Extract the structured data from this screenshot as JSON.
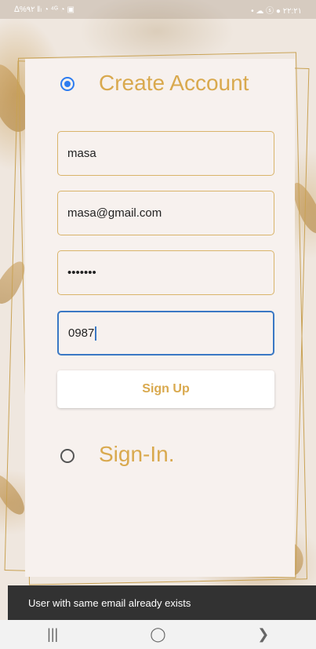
{
  "status_bar": {
    "left_text": "ᐃ%٩٢ ‖ₗ ◔ ⁴ᴳ ◔ ▣",
    "right_text": "• ☁ ⓢ ● ٢٢:٢١"
  },
  "create_account": {
    "heading": "Create Account",
    "selected": true
  },
  "form": {
    "name_value": "masa",
    "email_value": "masa@gmail.com",
    "password_value": "•••••••",
    "phone_value": "0987",
    "signup_label": "Sign Up"
  },
  "sign_in": {
    "heading": "Sign-In.",
    "selected": false
  },
  "snackbar": {
    "message": "User with same email already exists"
  },
  "nav": {
    "recents": "|||",
    "home": "◯",
    "back": "❯"
  },
  "colors": {
    "accent": "#d9a94e",
    "radio_selected": "#2d7cf0",
    "focus_border": "#3a78c4"
  }
}
